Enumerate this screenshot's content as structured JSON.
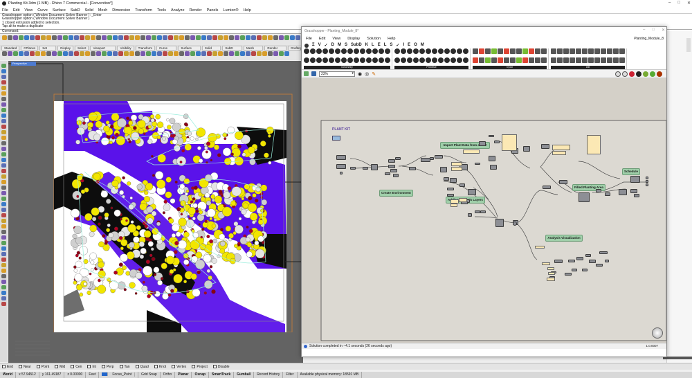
{
  "rhino": {
    "window_title": "Planting Kit.3dm (1 MB) - Rhino 7 Commercial - [Convention*]",
    "menu": [
      "File",
      "Edit",
      "View",
      "Curve",
      "Surface",
      "SubD",
      "Solid",
      "Mesh",
      "Dimension",
      "Transform",
      "Tools",
      "Analyze",
      "Render",
      "Panels",
      "Lumion®",
      "Help"
    ],
    "command_history": [
      "Grasshopper option ( Window  Document  Solver  Banner ): _Enter",
      "Grasshopper option ( Window  Document  Solver  Banner )",
      "1 closed extrusion added to selection.",
      "Tap alt to make a duplicate"
    ],
    "command_prompt": "Command:",
    "toolbar_tabs": [
      "Standard",
      "CPlanes",
      "Set View",
      "Display",
      "Select",
      "Viewport Layout",
      "Visibility",
      "Transform",
      "Curve Tools",
      "Surface Tools",
      "Solid Tools",
      "SubD Tools",
      "Mesh Tools",
      "Render Tools",
      "Drafting"
    ],
    "viewport_label": "Perspective"
  },
  "status": {
    "osnaps": [
      "End",
      "Near",
      "Point",
      "Mid",
      "Cen",
      "Int",
      "Perp",
      "Tan",
      "Quad",
      "Knot",
      "Vertex",
      "Project",
      "Disable"
    ],
    "cplane": "World",
    "x": "x 57.94512",
    "y": "y 161.49187",
    "z": "z 0.00000",
    "units": "Feet",
    "layer": "Focus_Point",
    "toggles": [
      "Grid Snap",
      "Ortho",
      "Planar",
      "Osnap",
      "SmartTrack",
      "Gumball",
      "Record History",
      "Filter"
    ],
    "memory": "Available physical memory: 18591 MB"
  },
  "grasshopper": {
    "title": "Grasshopper - Planting_Module_8*",
    "menu": [
      "File",
      "Edit",
      "View",
      "Display",
      "Solution",
      "Help"
    ],
    "document_name": "Planting_Module_8",
    "tabs": [
      "Σ",
      "V",
      "✓",
      "D",
      "M",
      "S",
      "SubD",
      "K",
      "L",
      "E",
      "L",
      "S",
      "✓",
      "I",
      "E",
      "O",
      "M"
    ],
    "panels": [
      "Geometry",
      "Primitive",
      "Input",
      "Util"
    ],
    "zoom": "23%",
    "status_text": "Solution completed in ~4.1 seconds (26 seconds ago)",
    "version": "1.0.0007",
    "groups": [
      "Import Plant Data from a CSV",
      "Create Environment",
      "Adding Analysis Layers",
      "Filled Planting Area",
      "Schedule",
      "Analysis Visualization"
    ],
    "logo_small": "PLANT KIT"
  }
}
